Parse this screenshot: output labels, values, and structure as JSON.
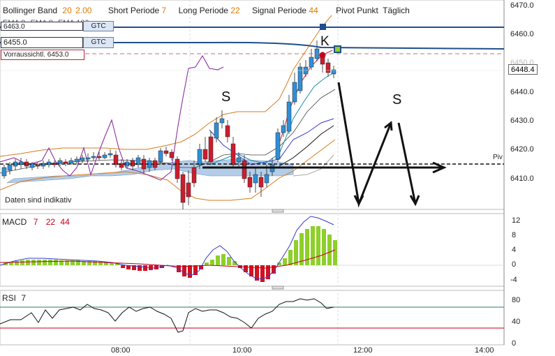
{
  "header": {
    "bb_name": "Bollinger Band",
    "bb_p1": "20",
    "bb_p2": "2.00",
    "short_label": "Short Periode",
    "short_val": "7",
    "long_label": "Long Periode",
    "long_val": "22",
    "signal_label": "Signal Periode",
    "signal_val": "44",
    "pivot_label": "Pivot Punkt",
    "pivot_val": "Täglich",
    "ema1": "EMA 9",
    "ema2": "EMA 9",
    "ema3": "EMA 100"
  },
  "orders": {
    "order1_price": "6463.0",
    "order1_tif": "GTC",
    "order2_price": "6455.0",
    "order2_tif": "GTC",
    "forecast": "Vorraussichtl. 6453.0"
  },
  "annotations": {
    "s_left": "S",
    "k_label": "K",
    "s_right": "S",
    "piv": "Piv"
  },
  "price_axis": [
    "6470.0",
    "6460.0",
    "6450.0",
    "6440.0",
    "6430.0",
    "6420.0",
    "6410.0"
  ],
  "current_price": "6448.4",
  "disclaimer": "Daten sind indikativ",
  "macd": {
    "name": "MACD",
    "p1": "7",
    "p2": "22",
    "p3": "44",
    "axis": [
      "12",
      "8",
      "4",
      "0",
      "-4"
    ]
  },
  "rsi": {
    "name": "RSI",
    "period": "7",
    "axis": [
      "80",
      "40",
      "0"
    ]
  },
  "time_axis": [
    "08:00",
    "10:00",
    "12:00",
    "14:00"
  ],
  "colors": {
    "bull": "#2f8fd8",
    "bear": "#cc1d2e",
    "ichimoku": "#b3cde8",
    "bb": "#d97a1a",
    "ema_purple": "#8e2fa4",
    "order_line": "#1f4e8c",
    "macd_pos": "#8ecf2a",
    "macd_neg": "#d3121f"
  },
  "icons": [
    "square-marker-icon",
    "circle-marker-icon",
    "drag-handle-icon"
  ]
}
